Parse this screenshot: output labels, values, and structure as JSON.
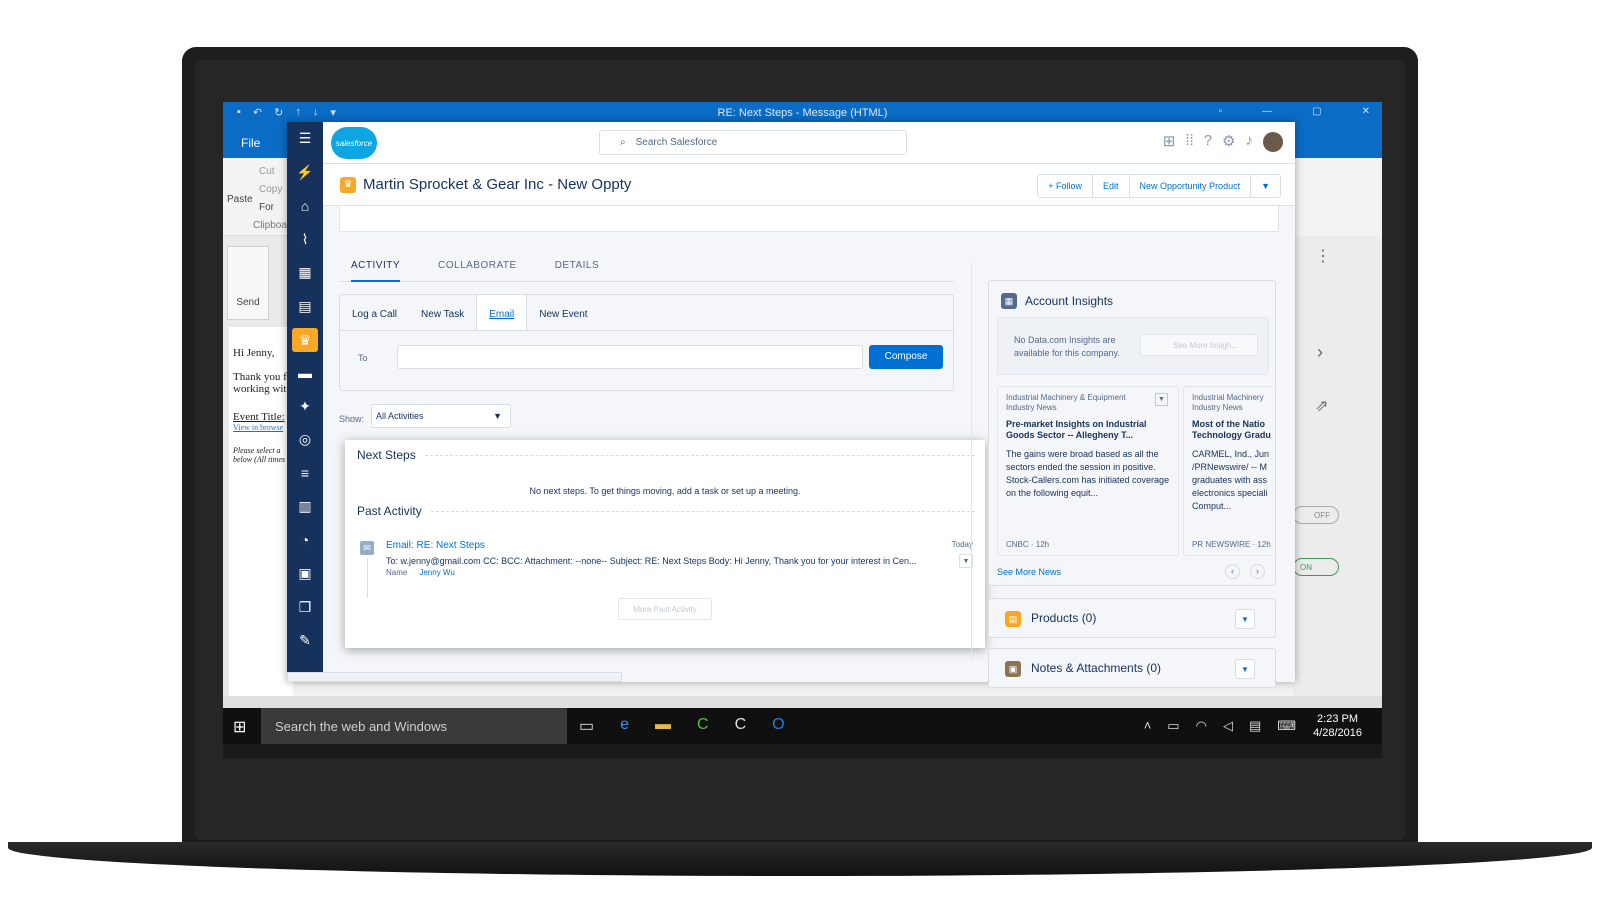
{
  "window": {
    "title": "RE: Next Steps - Message (HTML)"
  },
  "outlook": {
    "file_tab": "File",
    "ribbon": {
      "paste": "Paste",
      "cut": "Cut",
      "copy": "Copy",
      "format": "For",
      "clipboard": "Clipboa",
      "send": "Send"
    },
    "body": {
      "greeting": "Hi Jenny,",
      "line1": "Thank you f",
      "line2": "working wit",
      "event_title": "Event Title:",
      "view_browser": "View in browse",
      "please1": "Please select a",
      "please2": "below (All times"
    },
    "toggles": {
      "off": "OFF",
      "on": "ON"
    }
  },
  "taskbar": {
    "search_placeholder": "Search the web and Windows",
    "time": "2:23 PM",
    "date": "4/28/2016"
  },
  "salesforce": {
    "logo": "salesforce",
    "search_placeholder": "Search Salesforce",
    "record": {
      "title": "Martin Sprocket & Gear Inc - New Oppty",
      "actions": [
        "+ Follow",
        "Edit",
        "New Opportunity Product"
      ]
    },
    "tabs": [
      "ACTIVITY",
      "COLLABORATE",
      "DETAILS"
    ],
    "publisher": {
      "tabs": [
        "Log a Call",
        "New Task",
        "Email",
        "New Event"
      ],
      "to_label": "To",
      "compose": "Compose"
    },
    "show": {
      "label": "Show:",
      "value": "All Activities"
    },
    "timeline": {
      "next_steps": "Next Steps",
      "no_next_steps": "No next steps. To get things moving, add a task or set up a meeting.",
      "past_activity": "Past Activity",
      "email_subject": "Email: RE: Next Steps",
      "email_when": "Today",
      "email_body": "To: w.jenny@gmail.com CC: BCC: Attachment: --none-- Subject: RE: Next Steps Body: Hi Jenny,   Thank you for your interest in Cen...",
      "name_label": "Name",
      "name_value": "Jenny Wu",
      "more_past": "More Past Activity"
    },
    "insights": {
      "title": "Account Insights",
      "no_data": "No Data.com Insights are available for this company.",
      "see_more": "See More Insigh...",
      "news": [
        {
          "category": "Industrial Machinery & Equipment Industry News",
          "headline": "Pre-market Insights on Industrial Goods Sector -- Allegheny T...",
          "snippet": "The gains were broad based as all the sectors ended the session in positive. Stock-Callers.com has initiated coverage on the following equit...",
          "source": "CNBC · 12h"
        },
        {
          "category": "Industrial Machinery Industry News",
          "headline": "Most of the Natio Technology Gradu",
          "snippet": "CARMEL, Ind., Jun /PRNewswire/ -- M graduates with ass electronics speciali Comput...",
          "source": "PR NEWSWIRE · 12h"
        }
      ],
      "see_more_news": "See More News"
    },
    "products": "Products (0)",
    "notes": "Notes & Attachments (0)"
  }
}
